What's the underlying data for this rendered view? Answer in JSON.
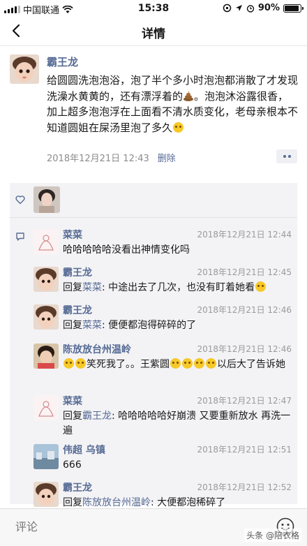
{
  "status_bar": {
    "carrier": "中国联通",
    "time": "15:38",
    "battery": "90%",
    "battery_level": 0.9
  },
  "nav": {
    "title": "详情",
    "back_icon": "chevron-left-icon"
  },
  "post": {
    "author": "霸王龙",
    "text_part1": "给圆圆洗泡泡浴，泡了半个多小时泡泡都消散了才发现洗澡水黄黄的，还有漂浮着的",
    "text_part2": "。泡泡沐浴露很香，加上超多泡泡浮在上面看不清水质变化，老母亲根本不知道圆姐在屎汤里泡了多久",
    "timestamp": "2018年12月21日 12:43",
    "delete_label": "删除"
  },
  "comments": [
    {
      "name": "菜菜",
      "time": "2018年12月21日 12:44",
      "text": "哈哈哈哈哈没看出神情变化吗"
    },
    {
      "name": "霸王龙",
      "time": "2018年12月21日 12:45",
      "reply_prefix": "回复",
      "reply_to": "菜菜",
      "text": ": 中途出去了几次，也没有盯着她看"
    },
    {
      "name": "霸王龙",
      "time": "2018年12月21日 12:46",
      "reply_prefix": "回复",
      "reply_to": "菜菜",
      "text": ": 便便都泡得碎碎的了"
    },
    {
      "name": "陈放放台州温岭",
      "time": "2018年12月21日 12:46",
      "text_part1": "笑死我了。。王紫圆",
      "text_part2": "以后大了告诉她"
    },
    {
      "name": "菜菜",
      "time": "2018年12月21日 12:47",
      "reply_prefix": "回复",
      "reply_to": "霸王龙",
      "text": ": 哈哈哈哈哈好崩溃 又要重新放水 再洗一遍"
    },
    {
      "name": "伟超 乌镇",
      "time": "2018年12月21日 12:51",
      "text": "666"
    },
    {
      "name": "霸王龙",
      "time": "2018年12月21日 12:52",
      "reply_prefix": "回复",
      "reply_to": "陈放放台州温岭",
      "text": ": 大便都泡稀碎了"
    }
  ],
  "bottom": {
    "input_placeholder": "评论",
    "watermark": "头条 @陪衣格"
  },
  "colors": {
    "link": "#576b95",
    "timestamp": "#8c8c8c",
    "comment_bg": "#f3f3f5"
  }
}
